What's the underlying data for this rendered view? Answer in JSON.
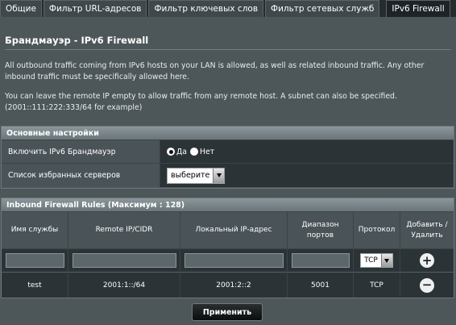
{
  "tabs": [
    {
      "label": "Общие",
      "active": false
    },
    {
      "label": "Фильтр URL-адресов",
      "active": false
    },
    {
      "label": "Фильтр ключевых слов",
      "active": false
    },
    {
      "label": "Фильтр сетевых служб",
      "active": false
    },
    {
      "label": "IPv6 Firewall",
      "active": true
    }
  ],
  "page": {
    "title": "Брандмауэр - IPv6 Firewall",
    "description_1": "All outbound traffic coming from IPv6 hosts on your LAN is allowed, as well as related inbound traffic. Any other inbound traffic must be specifically allowed here.",
    "description_2": "You can leave the remote IP empty to allow traffic from any remote host. A subnet can also be specified. (2001::111:222:333/64 for example)"
  },
  "settings": {
    "header": "Основные настройки",
    "enable_label": "Включить IPv6 Брандмауэр",
    "yes_label": "Да",
    "no_label": "Нет",
    "enabled": true,
    "favorites_label": "Список избранных серверов",
    "favorites_value": "выберите"
  },
  "rules": {
    "header": "Inbound Firewall Rules (Максимум : 128)",
    "columns": [
      "Имя службы",
      "Remote IP/CIDR",
      "Локальный IP-адрес",
      "Диапазон портов",
      "Протокол",
      "Добавить / Удалить"
    ],
    "new_protocol": "TCP",
    "add_icon": "plus-circle-icon",
    "delete_icon": "minus-circle-icon",
    "rows": [
      {
        "name": "test",
        "remote": "2001:1::/64",
        "local": "2001:2::2",
        "ports": "5001",
        "protocol": "TCP"
      }
    ]
  },
  "apply_label": "Применить"
}
